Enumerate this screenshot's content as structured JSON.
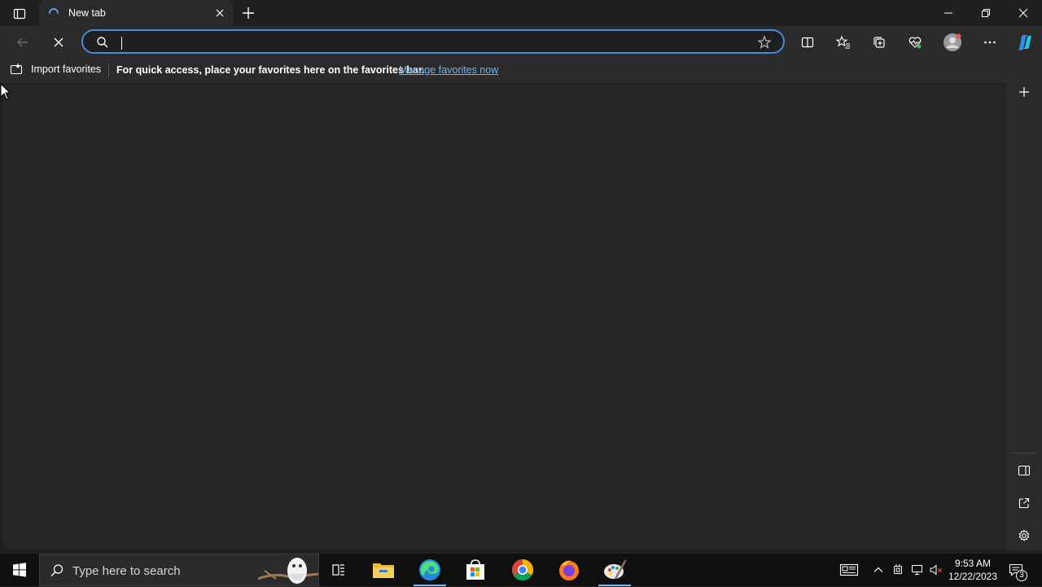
{
  "browser": {
    "tab": {
      "title": "New tab"
    },
    "address_bar": {
      "value": "",
      "placeholder": ""
    },
    "favorites_bar": {
      "import_label": "Import favorites",
      "message": "For quick access, place your favorites here on the favorites bar.",
      "manage_link": "Manage favorites now"
    }
  },
  "taskbar": {
    "search_placeholder": "Type here to search",
    "clock": {
      "time": "9:53 AM",
      "date": "12/22/2023"
    },
    "notification_count": "3"
  },
  "colors": {
    "accent": "#4a8bd6",
    "link": "#6fb2f0",
    "active_indicator": "#76b9ed"
  }
}
